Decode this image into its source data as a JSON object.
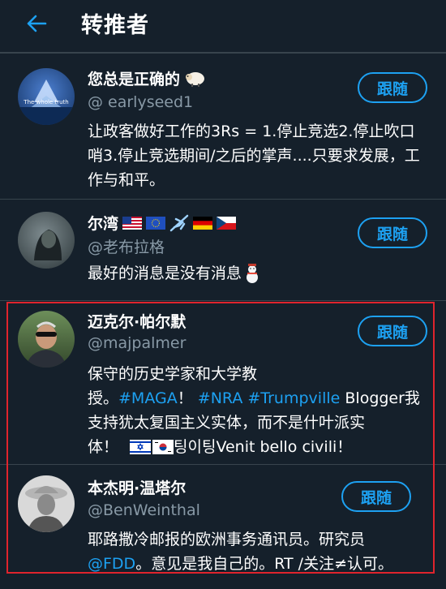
{
  "header": {
    "title": "转推者",
    "back_icon": "arrow-left-icon"
  },
  "colors": {
    "background": "#15202b",
    "accent": "#1da1f2",
    "muted": "#8899a6",
    "divider": "#38444d",
    "highlight": "#e0242d"
  },
  "users": [
    {
      "name": "您总是正确的",
      "handle": "@ earlyseed1",
      "avatar_caption": "The whole truth",
      "bio": "让政客做好工作的3Rs = 1.停止竞选2.停止吹口哨3.停止竞选期间/之后的掌声....只要求发展，工作与和平。",
      "follow_label": "跟随"
    },
    {
      "name": "尔湾",
      "handle": "@老布拉格",
      "bio": "最好的消息是没有消息",
      "follow_label": "跟随"
    },
    {
      "name": "迈克尔·帕尔默",
      "handle": "@majpalmer",
      "bio_parts": {
        "line1": "保守的历史学家和大学教",
        "line2_a": "授。",
        "tag_maga": "#MAGA",
        "line2_b": "！",
        "tag_nra": "#NRA",
        "tag_trumpville": "#Trumpville",
        "line2_c": "Blogger我",
        "line3": "支持犹太复国主义实体，而不是什叶派实",
        "line4_a": "体！",
        "line4_b": "팅이팅Venit bello civili！"
      },
      "follow_label": "跟随"
    },
    {
      "name": "本杰明·温塔尔",
      "handle": "@BenWeinthal",
      "bio_parts": {
        "line1": "耶路撒冷邮报的欧洲事务通讯员。研究员",
        "mention": "@FDD",
        "line2": "。意见是我自己的。RT /关注≠认可。"
      },
      "follow_label": "跟随"
    }
  ]
}
